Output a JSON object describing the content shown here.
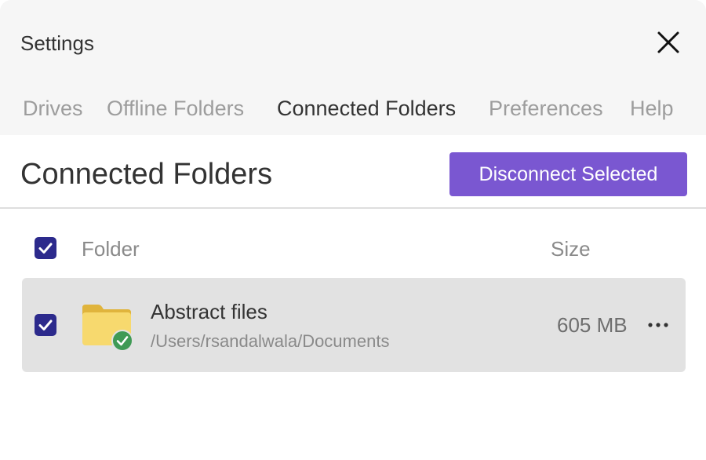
{
  "window": {
    "title": "Settings",
    "close_icon": "close-icon"
  },
  "tabs": [
    {
      "label": "Drives",
      "active": false
    },
    {
      "label": "Offline Folders",
      "active": false
    },
    {
      "label": "Connected Folders",
      "active": true
    },
    {
      "label": "Preferences",
      "active": false
    },
    {
      "label": "Help",
      "active": false
    }
  ],
  "main": {
    "title": "Connected Folders",
    "disconnect_label": "Disconnect Selected",
    "table": {
      "header_checked": true,
      "columns": [
        "Folder",
        "Size"
      ],
      "rows": [
        {
          "checked": true,
          "name": "Abstract files",
          "path": "/Users/rsandalwala/Documents",
          "size": "605 MB",
          "icon": "folder-icon",
          "status_icon": "check-circle-icon",
          "menu_icon": "more-horizontal-icon"
        }
      ]
    }
  },
  "colors": {
    "accent": "#7a57d1",
    "checkbox": "#2c2a8c",
    "folder": "#f5d76e",
    "status_ok": "#3f9a55"
  }
}
